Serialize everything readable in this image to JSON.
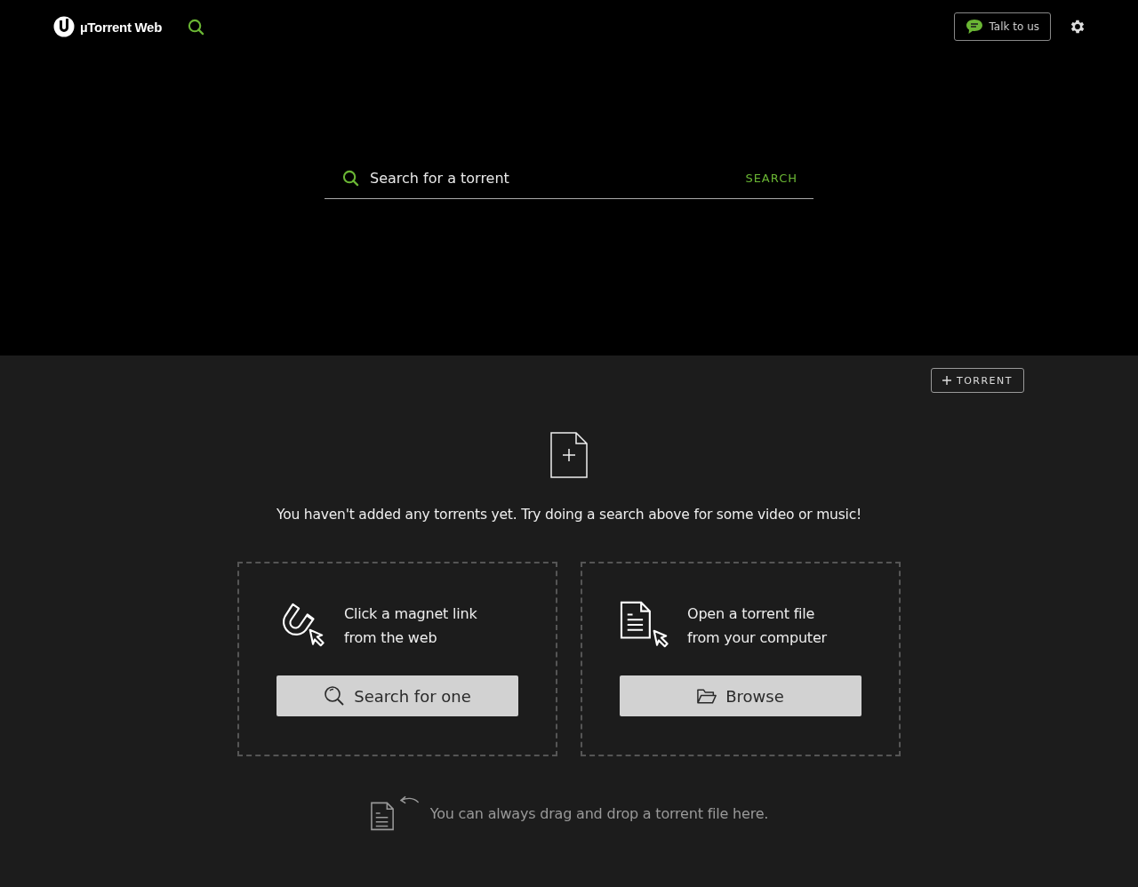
{
  "header": {
    "brand": "µTorrent Web",
    "talk_button": "Talk to us"
  },
  "search": {
    "placeholder": "Search for a torrent",
    "button": "SEARCH"
  },
  "add_torrent_button": "TORRENT",
  "empty_message": "You haven't added any torrents yet. Try doing a search above for some video or music!",
  "cards": [
    {
      "kind": "magnet",
      "lines": [
        "Click a magnet link",
        "from the web"
      ],
      "button": "Search for one"
    },
    {
      "kind": "file",
      "lines": [
        "Open a torrent file",
        "from your computer"
      ],
      "button": "Browse"
    }
  ],
  "drop_hint": "You can always drag and drop a torrent file here."
}
